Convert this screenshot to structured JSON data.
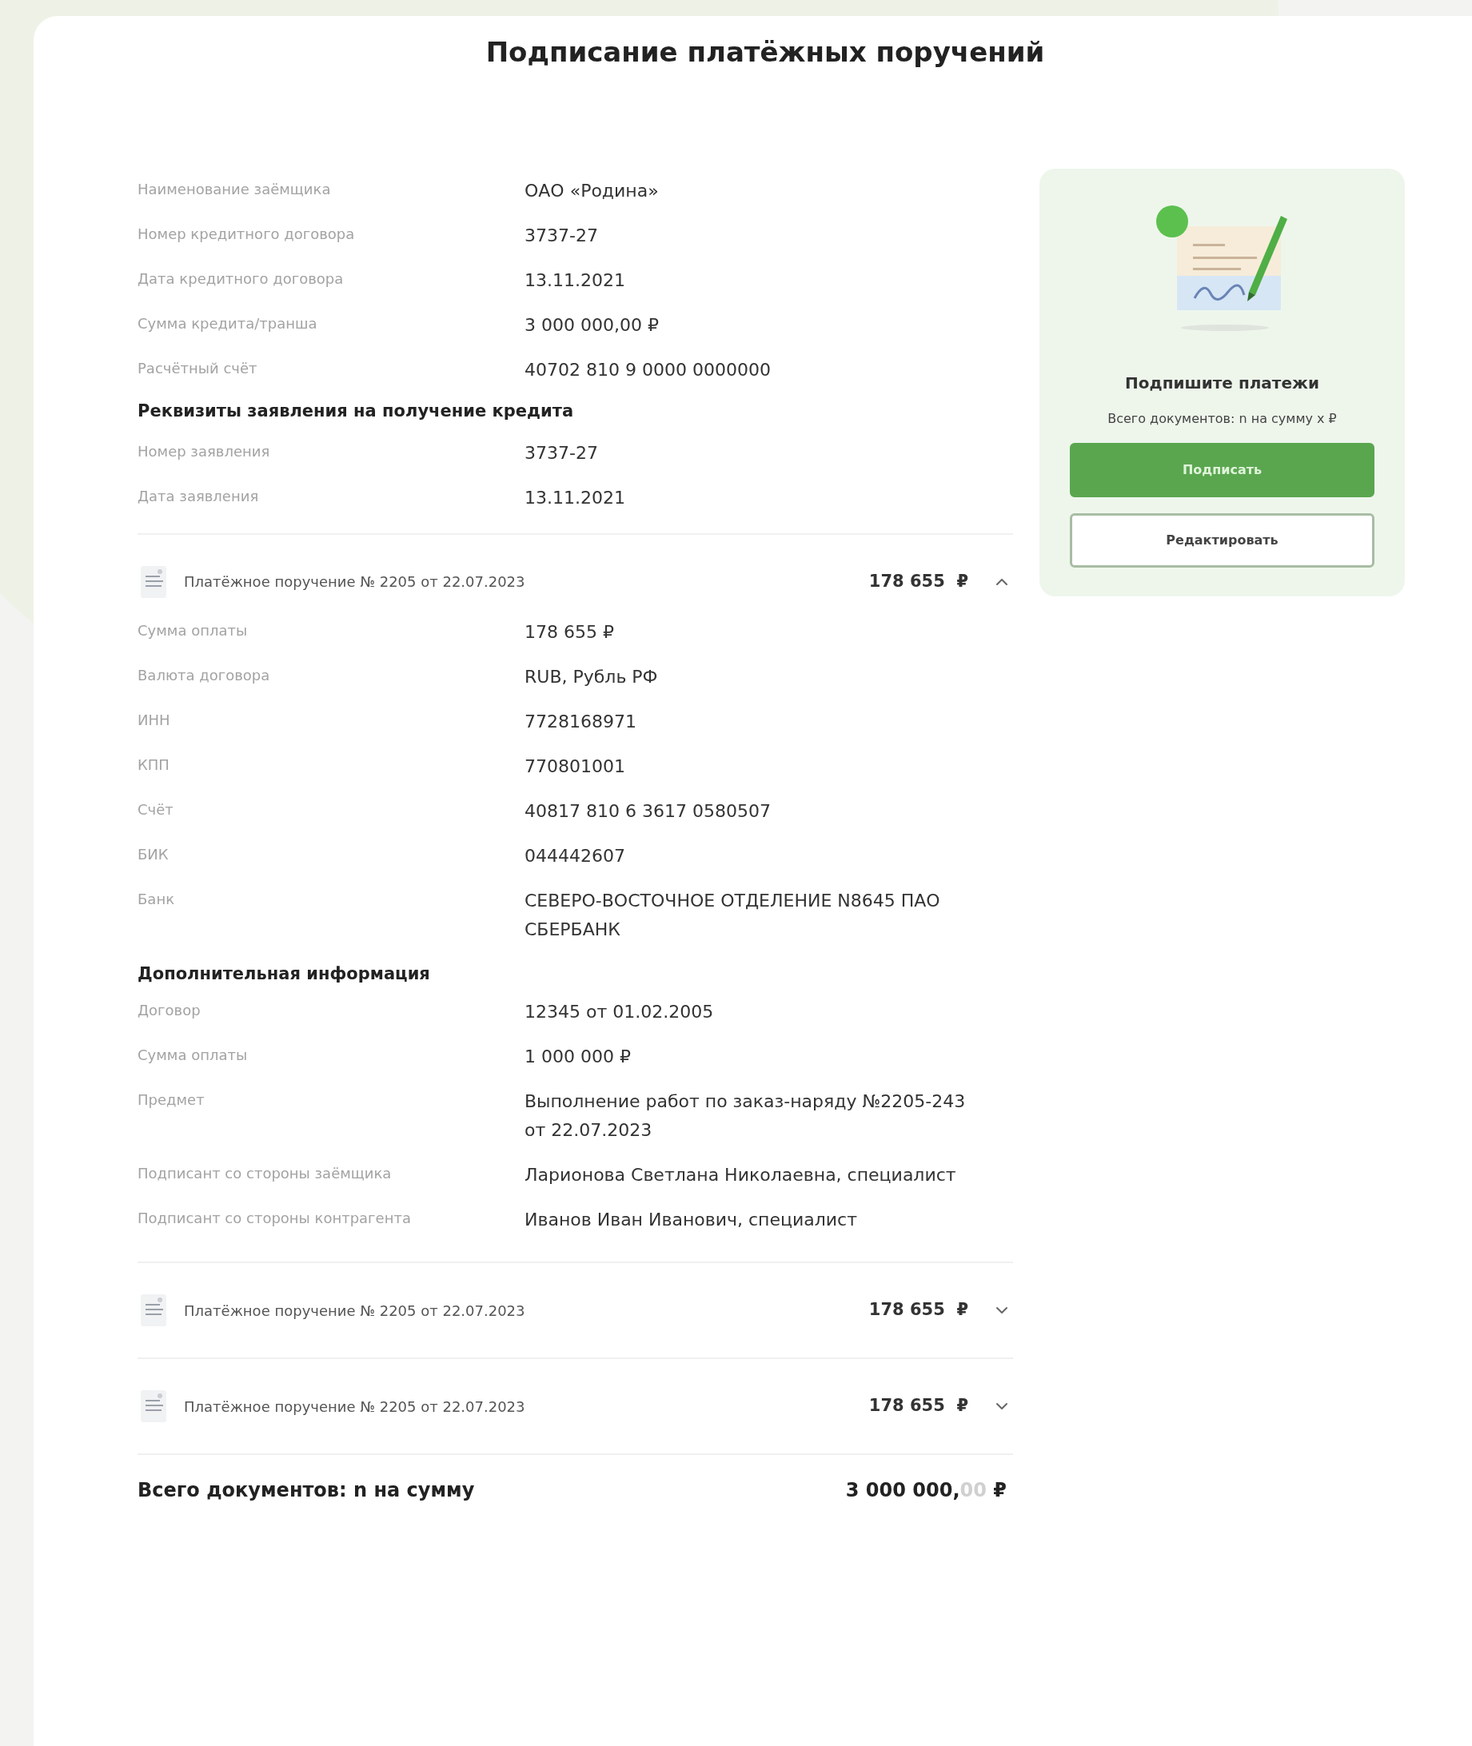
{
  "title": "Подписание платёжных поручений",
  "borrower_details": [
    {
      "label": "Наименование заёмщика",
      "value": "ОАО «Родина»"
    },
    {
      "label": "Номер кредитного договора",
      "value": "3737-27"
    },
    {
      "label": "Дата кредитного договора",
      "value": "13.11.2021"
    },
    {
      "label": "Сумма кредита/транша",
      "value": "3 000 000,00 ₽"
    },
    {
      "label": "Расчётный счёт",
      "value": "40702 810 9 0000 0000000"
    }
  ],
  "application": {
    "heading": "Реквизиты заявления на получение кредита",
    "rows": [
      {
        "label": "Номер заявления",
        "value": "3737-27"
      },
      {
        "label": "Дата заявления",
        "value": "13.11.2021"
      }
    ]
  },
  "payment_orders": [
    {
      "title": "Платёжное поручение № 2205 от 22.07.2023",
      "amount": "178 655  ₽",
      "expanded": true,
      "rows": [
        {
          "label": "Сумма оплаты",
          "value": "178 655 ₽"
        },
        {
          "label": "Валюта договора",
          "value": "RUB, Рубль РФ"
        },
        {
          "label": "ИНН",
          "value": "7728168971"
        },
        {
          "label": "КПП",
          "value": "770801001"
        },
        {
          "label": "Счёт",
          "value": "40817 810 6 3617 0580507"
        },
        {
          "label": "БИК",
          "value": "044442607"
        },
        {
          "label": "Банк",
          "value": "СЕВЕРО-ВОСТОЧНОЕ ОТДЕЛЕНИЕ N8645 ПАО СБЕРБАНК"
        }
      ],
      "extra": {
        "heading": "Дополнительная информация",
        "rows": [
          {
            "label": "Договор",
            "value": "12345 от 01.02.2005"
          },
          {
            "label": "Сумма оплаты",
            "value": "1 000 000 ₽"
          },
          {
            "label": "Предмет",
            "value": "Выполнение работ по заказ-наряду №2205-243 от 22.07.2023"
          },
          {
            "label": "Подписант со стороны заёмщика",
            "value": "Ларионова Светлана Николаевна, специалист"
          },
          {
            "label": "Подписант со стороны контрагента",
            "value": "Иванов Иван Иванович, специалист"
          }
        ]
      }
    },
    {
      "title": "Платёжное поручение № 2205 от 22.07.2023",
      "amount": "178 655  ₽",
      "expanded": false
    },
    {
      "title": "Платёжное поручение № 2205 от 22.07.2023",
      "amount": "178 655  ₽",
      "expanded": false
    }
  ],
  "total": {
    "label": "Всего документов: n на сумму",
    "amount": "3 000 000,",
    "cents": "00",
    "currency": "₽"
  },
  "sign_panel": {
    "title": "Подпишите платежи",
    "subtitle": "Всего документов: n на сумму x ₽",
    "buttons": [
      {
        "label": "Подписать",
        "kind": "primary"
      },
      {
        "label": "Редактировать",
        "kind": "secondary"
      }
    ]
  }
}
